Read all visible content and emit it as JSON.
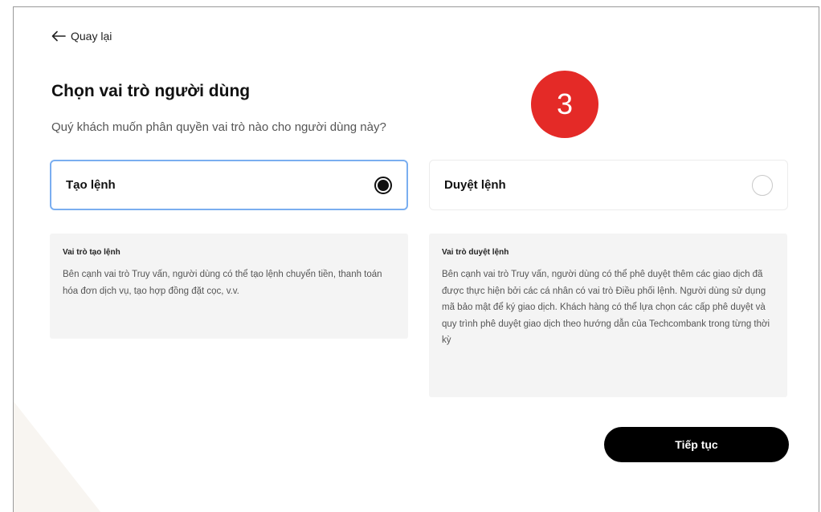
{
  "back": {
    "icon": "arrow-left-icon",
    "label": "Quay lại"
  },
  "header": {
    "title": "Chọn vai trò người dùng",
    "subtitle": "Quý khách muốn phân quyền vai trò nào cho người dùng này?"
  },
  "step_badge": {
    "value": "3",
    "color": "#e42a27"
  },
  "options": [
    {
      "label": "Tạo lệnh",
      "selected": true
    },
    {
      "label": "Duyệt lệnh",
      "selected": false
    }
  ],
  "descriptions": [
    {
      "title": "Vai trò tạo lệnh",
      "text": "Bên cạnh vai trò Truy vấn, người dùng có thể tạo lệnh chuyển tiền, thanh toán hóa đơn dịch vụ, tạo hợp đồng đặt cọc, v.v."
    },
    {
      "title": "Vai trò duyệt lệnh",
      "text": "Bên cạnh vai trò Truy vấn, người dùng có thể phê duyệt thêm các giao dịch đã được thực hiện bởi các cá nhân có vai trò Điều phối lệnh. Người dùng sử dụng mã bảo mật để ký giao dịch. Khách hàng có thể lựa chọn các cấp phê duyệt và quy trình phê duyệt giao dịch theo hướng dẫn của Techcombank trong từng thời kỳ"
    }
  ],
  "actions": {
    "continue_label": "Tiếp tục"
  },
  "colors": {
    "selected_border": "#7aaef0",
    "primary_button": "#000000"
  }
}
